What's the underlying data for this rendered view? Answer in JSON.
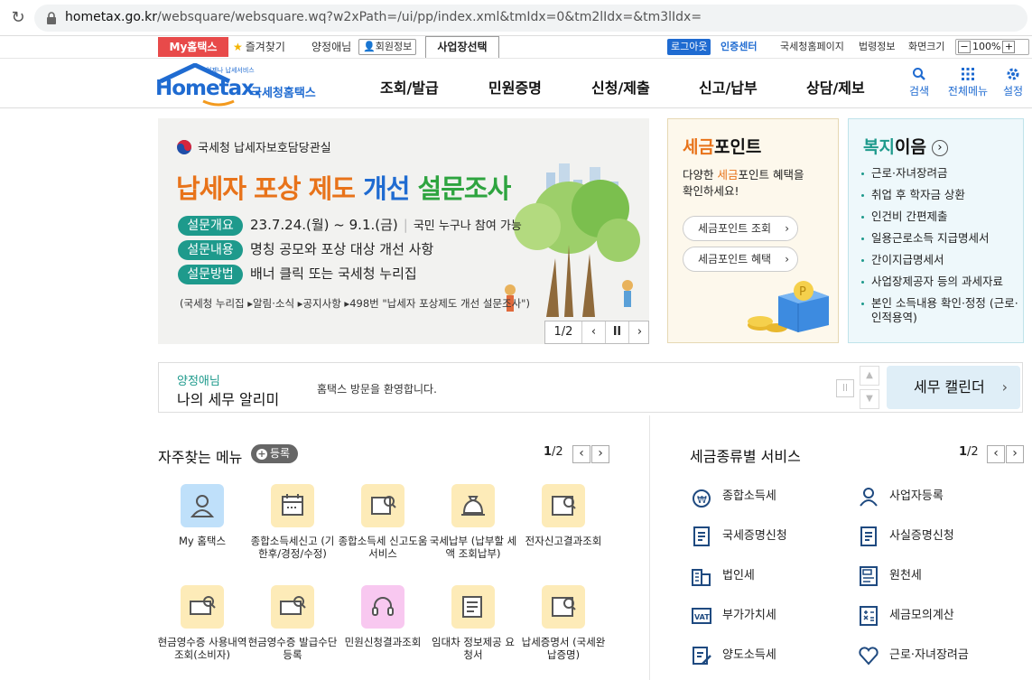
{
  "browser": {
    "url_host": "hometax.go.kr",
    "url_path": "/websquare/websquare.wq?w2xPath=/ui/pp/index.xml&tmIdx=0&tm2lIdx=&tm3lIdx="
  },
  "util": {
    "my_hometax": "My홈택스",
    "favorites": "즐겨찾기",
    "user_name": "양정애님",
    "member_info": "회원정보",
    "biz_select": "사업장선택",
    "logout": "로그아웃",
    "cert_center": "인증센터",
    "nts_home": "국세청홈페이지",
    "law_info": "법령정보",
    "zoom_label": "화면크기",
    "zoom_value": "100%"
  },
  "header": {
    "logo_small": "언제나 납세서비스",
    "logo_main": "Hometax.",
    "logo_sub": "국세청홈택스",
    "nav": [
      "조회/발급",
      "민원증명",
      "신청/제출",
      "신고/납부",
      "상담/제보"
    ],
    "search": "검색",
    "all_menu": "전체메뉴",
    "settings": "설정"
  },
  "banner": {
    "org": "국세청 납세자보호담당관실",
    "title_part1": "납세자 포상 제도 ",
    "title_part2": "개선 ",
    "title_part3": "설문조사",
    "rows": [
      {
        "label": "설문개요",
        "text": "23.7.24.(월) ~ 9.1.(금)",
        "extra": "국민 누구나 참여 가능"
      },
      {
        "label": "설문내용",
        "text": "명칭 공모와 포상 대상 개선 사항",
        "extra": ""
      },
      {
        "label": "설문방법",
        "text": "배너 클릭 또는 국세청 누리집",
        "extra": ""
      }
    ],
    "note": "(국세청 누리집 ▸알림·소식 ▸공지사항 ▸498번 \"납세자 포상제도 개선 설문조사\")",
    "page": "1/2"
  },
  "point_box": {
    "title_part1": "세금",
    "title_part2": "포인트",
    "desc1_a": "다양한 ",
    "desc1_b": "세금",
    "desc1_c": "포인트 혜택을",
    "desc2": "확인하세요!",
    "btn1": "세금포인트 조회",
    "btn2": "세금포인트 혜택"
  },
  "welfare_box": {
    "title_part1": "복지",
    "title_part2": "이음",
    "items": [
      "근로·자녀장려금",
      "취업 후 학자금 상환",
      "인건비 간편제출",
      "일용근로소득 지급명세서",
      "간이지급명세서",
      "사업장제공자 등의 과세자료",
      "본인 소득내용 확인·정정 (근로·인적용역)"
    ]
  },
  "alarm": {
    "user": "양정애님",
    "title": "나의 세무 알리미",
    "message": "홈택스 방문을 환영합니다.",
    "calendar": "세무 캘린더"
  },
  "quick_menu": {
    "title": "자주찾는 메뉴",
    "add_btn": "등록",
    "page_cur": "1",
    "page_total": "/2",
    "items": [
      {
        "label": "My 홈택스"
      },
      {
        "label": "종합소득세신고 (기한후/경정/수정)"
      },
      {
        "label": "종합소득세 신고도움 서비스"
      },
      {
        "label": "국세납부 (납부할 세액 조회납부)"
      },
      {
        "label": "전자신고결과조회"
      },
      {
        "label": "현금영수증 사용내역조회(소비자)"
      },
      {
        "label": "현금영수증 발급수단 등록"
      },
      {
        "label": "민원신청결과조회"
      },
      {
        "label": "임대차 정보제공 요청서"
      },
      {
        "label": "납세증명서 (국세완납증명)"
      }
    ]
  },
  "tax_service": {
    "title": "세금종류별 서비스",
    "page_cur": "1",
    "page_total": "/2",
    "left": [
      "종합소득세",
      "국세증명신청",
      "법인세",
      "부가가치세",
      "양도소득세"
    ],
    "right": [
      "사업자등록",
      "사실증명신청",
      "원천세",
      "세금모의계산",
      "근로·자녀장려금"
    ]
  },
  "colors": {
    "accent_blue": "#1f6bd1",
    "teal": "#1e9a8c",
    "orange": "#e8731a",
    "red": "#e84a4a"
  }
}
